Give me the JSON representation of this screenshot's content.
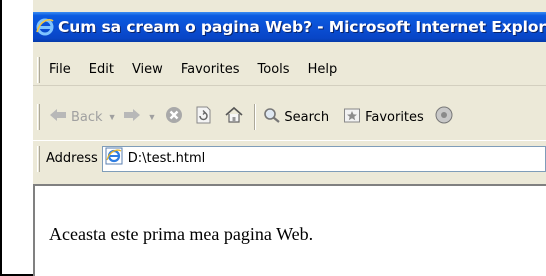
{
  "window": {
    "title": "Cum sa cream o pagina Web? - Microsoft Internet Explorer"
  },
  "menu": {
    "items": [
      "File",
      "Edit",
      "View",
      "Favorites",
      "Tools",
      "Help"
    ]
  },
  "toolbar": {
    "back_label": "Back",
    "search_label": "Search",
    "favorites_label": "Favorites"
  },
  "address": {
    "label": "Address",
    "value": "D:\\test.html"
  },
  "content": {
    "text": "Aceasta este prima mea pagina Web."
  },
  "colors": {
    "titlebar": "#0a4fd4",
    "chrome": "#ece9d8"
  }
}
